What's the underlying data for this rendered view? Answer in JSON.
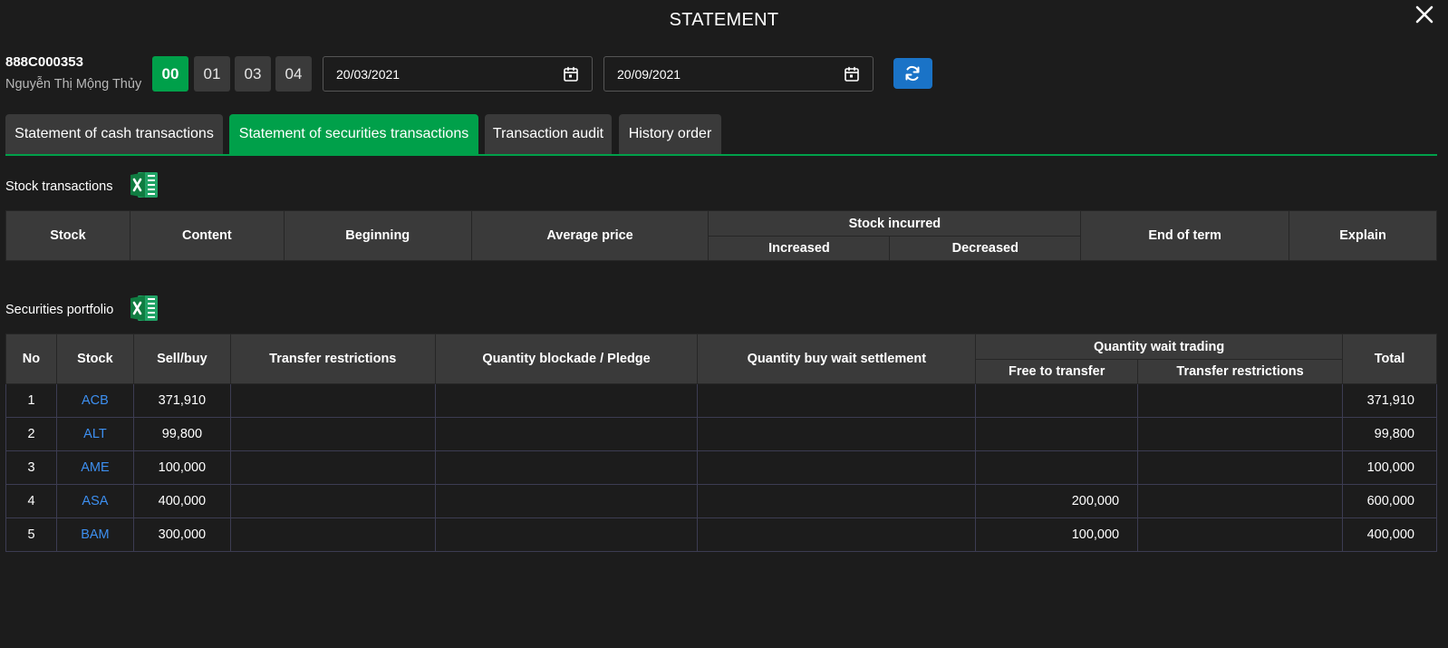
{
  "title": "STATEMENT",
  "account": {
    "number": "888C000353",
    "name": "Nguyễn Thị Mộng Thủy"
  },
  "sub_accounts": [
    {
      "label": "00",
      "active": true
    },
    {
      "label": "01",
      "active": false
    },
    {
      "label": "03",
      "active": false
    },
    {
      "label": "04",
      "active": false
    }
  ],
  "date_from": "20/03/2021",
  "date_to": "20/09/2021",
  "tabs": [
    {
      "label": "Statement of cash transactions",
      "active": false
    },
    {
      "label": "Statement of securities transactions",
      "active": true
    },
    {
      "label": "Transaction audit",
      "active": false
    },
    {
      "label": "History order",
      "active": false
    }
  ],
  "stock_transactions": {
    "label": "Stock transactions",
    "headers": {
      "stock": "Stock",
      "content": "Content",
      "beginning": "Beginning",
      "average_price": "Average price",
      "stock_incurred": "Stock incurred",
      "increased": "Increased",
      "decreased": "Decreased",
      "end_of_term": "End of term",
      "explain": "Explain"
    }
  },
  "portfolio": {
    "label": "Securities portfolio",
    "headers": {
      "no": "No",
      "stock": "Stock",
      "sell_buy": "Sell/buy",
      "transfer_restrictions": "Transfer restrictions",
      "quantity_blockade": "Quantity blockade / Pledge",
      "quantity_buy_wait": "Quantity buy wait settlement",
      "quantity_wait_trading": "Quantity wait trading",
      "free_to_transfer": "Free to transfer",
      "wait_transfer_restrictions": "Transfer restrictions",
      "total": "Total"
    },
    "rows": [
      {
        "no": "1",
        "stock": "ACB",
        "sell_buy": "371,910",
        "transfer_restrictions": "",
        "blockade": "",
        "buy_wait": "",
        "free_to_transfer": "",
        "wait_restrictions": "",
        "total": "371,910"
      },
      {
        "no": "2",
        "stock": "ALT",
        "sell_buy": "99,800",
        "transfer_restrictions": "",
        "blockade": "",
        "buy_wait": "",
        "free_to_transfer": "",
        "wait_restrictions": "",
        "total": "99,800"
      },
      {
        "no": "3",
        "stock": "AME",
        "sell_buy": "100,000",
        "transfer_restrictions": "",
        "blockade": "",
        "buy_wait": "",
        "free_to_transfer": "",
        "wait_restrictions": "",
        "total": "100,000"
      },
      {
        "no": "4",
        "stock": "ASA",
        "sell_buy": "400,000",
        "transfer_restrictions": "",
        "blockade": "",
        "buy_wait": "",
        "free_to_transfer": "200,000",
        "wait_restrictions": "",
        "total": "600,000"
      },
      {
        "no": "5",
        "stock": "BAM",
        "sell_buy": "300,000",
        "transfer_restrictions": "",
        "blockade": "",
        "buy_wait": "",
        "free_to_transfer": "100,000",
        "wait_restrictions": "",
        "total": "400,000"
      }
    ]
  },
  "colors": {
    "accent": "#00a04a",
    "link": "#3d8ff0",
    "refresh": "#1a73c7",
    "background": "#1c1c1c",
    "header": "#3a3a3a"
  },
  "icons": {
    "close": "close-icon",
    "calendar": "calendar-icon",
    "refresh": "refresh-icon",
    "excel": "excel-icon"
  }
}
